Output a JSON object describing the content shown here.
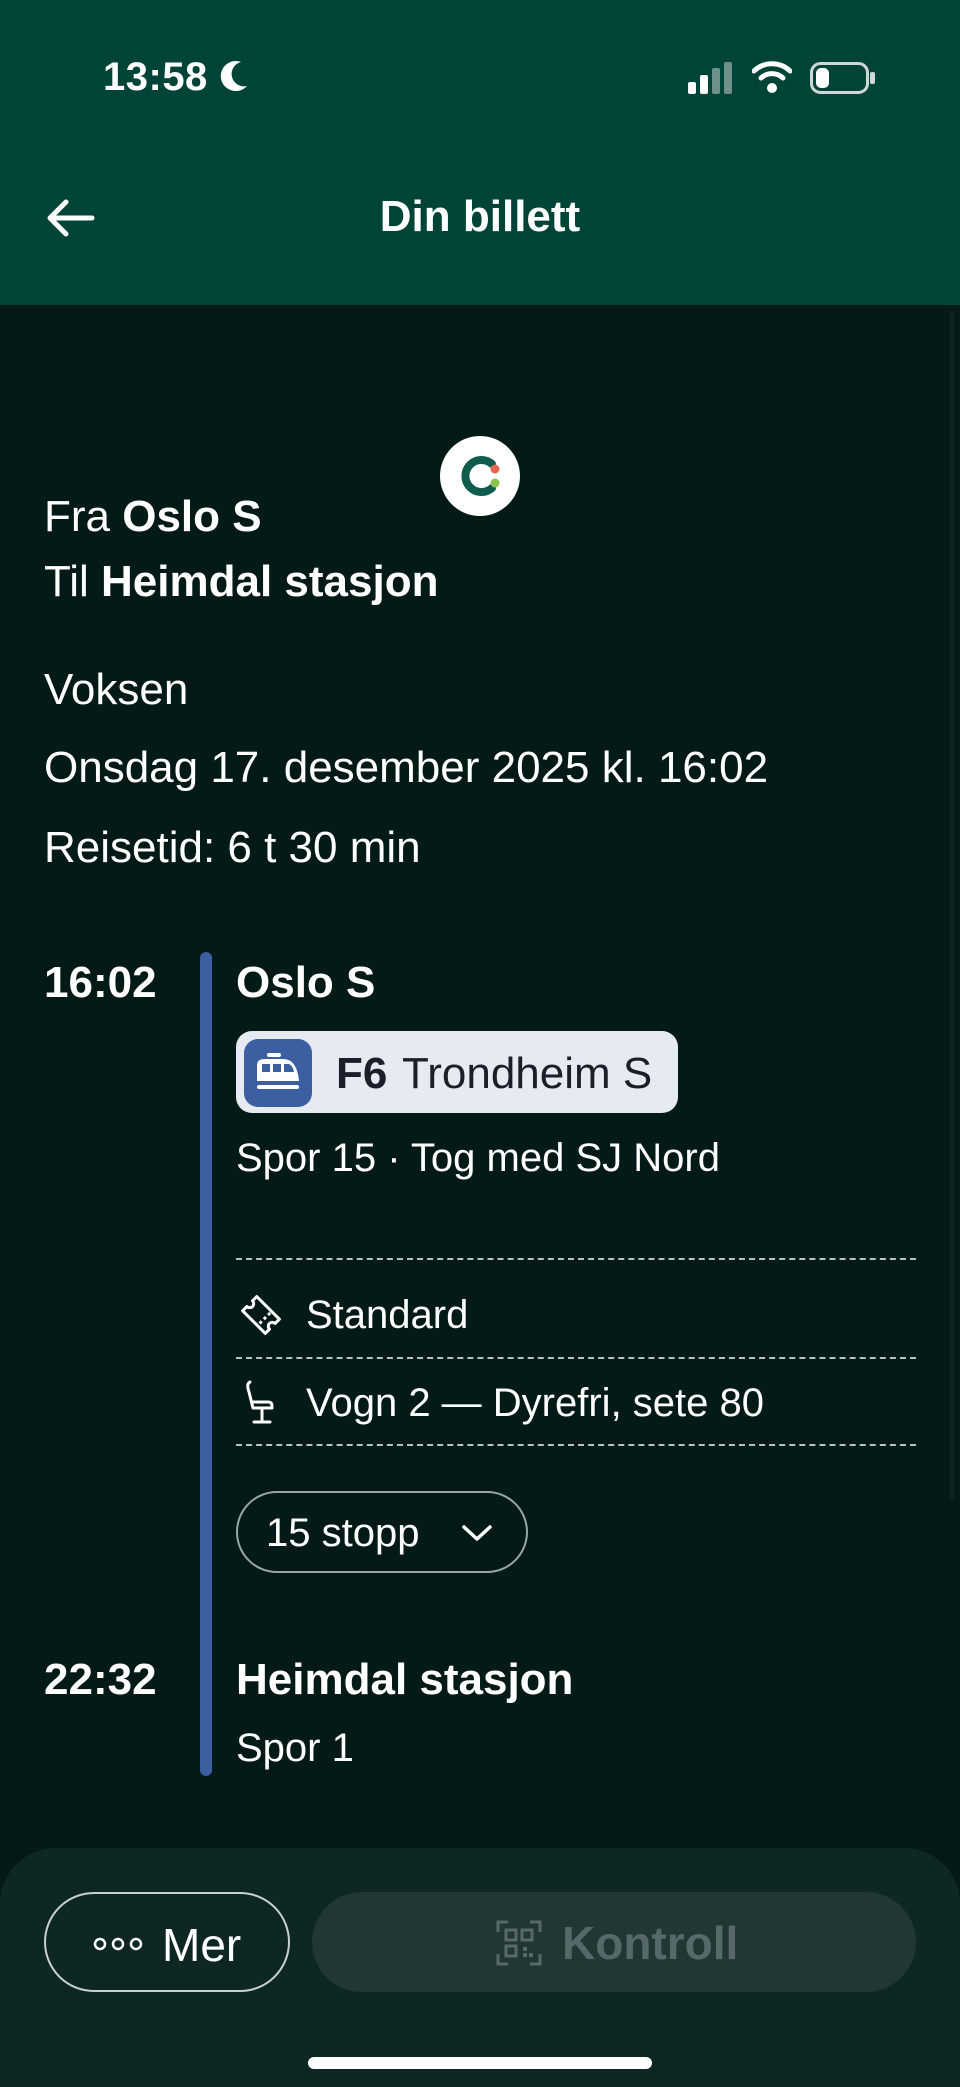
{
  "status_bar": {
    "time": "13:58",
    "icons": [
      "moon-icon",
      "signal-icon",
      "wifi-icon",
      "battery-icon"
    ]
  },
  "header": {
    "title": "Din billett",
    "back_icon": "arrow-left-icon"
  },
  "route": {
    "from_label": "Fra",
    "from": "Oslo S",
    "to_label": "Til",
    "to": "Heimdal stasjon"
  },
  "ticket": {
    "passenger": "Voksen",
    "date_time": "Onsdag 17. desember 2025 kl. 16:02",
    "travel_time": "Reisetid: 6 t 30 min"
  },
  "journey": {
    "departure": {
      "time": "16:02",
      "station": "Oslo S",
      "line": "F6",
      "destination": "Trondheim S",
      "platform_info": "Spor 15 · Tog med SJ Nord"
    },
    "ticket_class": "Standard",
    "seat": "Vogn 2 — Dyrefri, sete 80",
    "stops_button": "15 stopp",
    "arrival": {
      "time": "22:32",
      "station": "Heimdal stasjon",
      "platform": "Spor 1"
    }
  },
  "actions": {
    "more_label": "Mer",
    "control_label": "Kontroll"
  },
  "colors": {
    "header_bg": "#004438",
    "page_bg": "#031a17",
    "timeline": "#3b5fa1",
    "badge_bg": "#e6eaf3",
    "disabled_text": "#56686a"
  }
}
